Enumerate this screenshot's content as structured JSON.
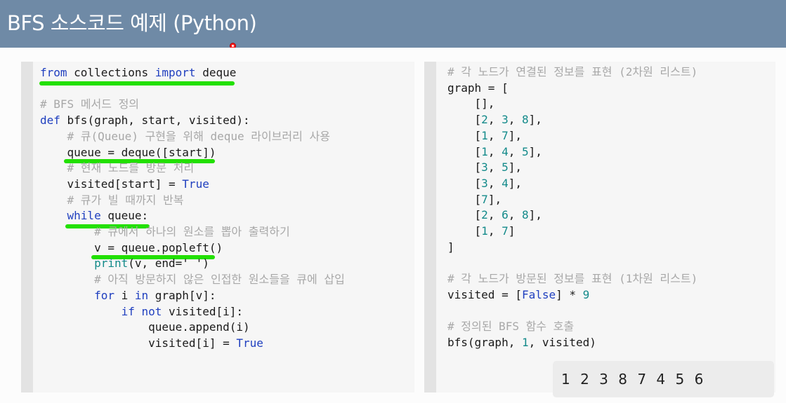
{
  "slide": {
    "title": "BFS 소스코드 예제 (Python)"
  },
  "left_code": {
    "l1": {
      "kw1": "from",
      "mid": " collections ",
      "kw2": "import",
      "end": " deque"
    },
    "l3": "# BFS 메서드 정의",
    "l4": {
      "kw": "def",
      "rest": " bfs(graph, start, visited):"
    },
    "l5": "# 큐(Queue) 구현을 위해 deque 라이브러리 사용",
    "l6": "queue = deque([start])",
    "l7": "# 현재 노드를 방문 처리",
    "l8": {
      "a": "visited[start] = ",
      "b": "True"
    },
    "l9": "# 큐가 빌 때까지 반복",
    "l10": {
      "kw": "while",
      "rest": " queue:"
    },
    "l11": "# 큐에서 하나의 원소를 뽑아 출력하기",
    "l12": "v = queue.popleft()",
    "l13": {
      "fn": "print",
      "rest": "(v, end=' ')"
    },
    "l14": "# 아직 방문하지 않은 인접한 원소들을 큐에 삽입",
    "l15": {
      "kw1": "for",
      "mid": " i ",
      "kw2": "in",
      "rest": " graph[v]:"
    },
    "l16": {
      "kw1": "if",
      "kw2": "not",
      "rest": " visited[i]:"
    },
    "l17": "queue.append(i)",
    "l18": {
      "a": "visited[i] = ",
      "b": "True"
    }
  },
  "right_code": {
    "c1": "# 각 노드가 연결된 정보를 표현 (2차원 리스트)",
    "g0": "graph = [",
    "rows": [
      "[],",
      "[2, 3, 8],",
      "[1, 7],",
      "[1, 4, 5],",
      "[3, 5],",
      "[3, 4],",
      "[7],",
      "[2, 6, 8],",
      "[1, 7]"
    ],
    "gend": "]",
    "c2": "# 각 노드가 방문된 정보를 표현 (1차원 리스트)",
    "v": {
      "a": "visited = [",
      "b": "False",
      "c": "] * ",
      "d": "9"
    },
    "c3": "# 정의된 BFS 함수 호출",
    "call": {
      "a": "bfs(graph, ",
      "b": "1",
      "c": ", visited)"
    }
  },
  "output": {
    "text": "1 2 3 8 7 4 5 6"
  },
  "colors": {
    "header": "#6f8aa6",
    "highlight": "#22e000",
    "keyword": "#1f3fbf",
    "comment": "#a8a8a8"
  }
}
